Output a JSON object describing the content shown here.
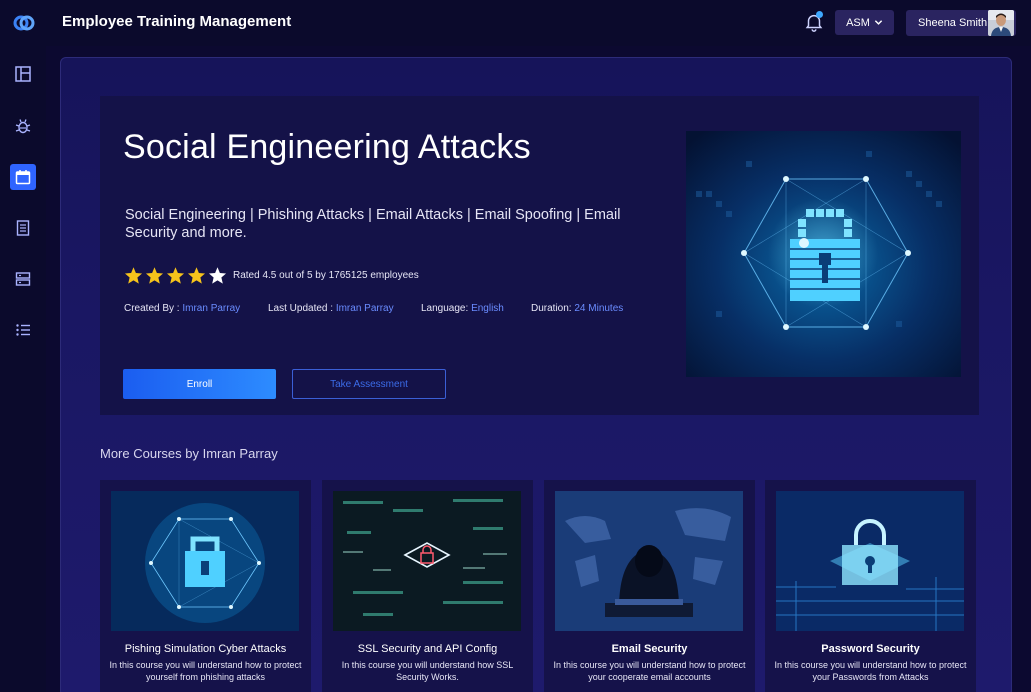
{
  "app": {
    "title": "Employee Training Management"
  },
  "header": {
    "org_selector": "ASM",
    "user_name": "Sheena Smith",
    "icons": [
      "logo-icon",
      "bell-icon",
      "chevron-down-icon"
    ]
  },
  "sidebar": {
    "items": [
      {
        "name": "dashboard",
        "icon": "layout-icon",
        "active": false
      },
      {
        "name": "bugs",
        "icon": "bug-icon",
        "active": false
      },
      {
        "name": "calendar",
        "icon": "calendar-icon",
        "active": true
      },
      {
        "name": "documents",
        "icon": "document-icon",
        "active": false
      },
      {
        "name": "storage",
        "icon": "server-icon",
        "active": false
      },
      {
        "name": "list",
        "icon": "list-icon",
        "active": false
      }
    ]
  },
  "course": {
    "title": "Social Engineering Attacks",
    "tags": "Social Engineering | Phishing Attacks | Email Attacks | Email Spoofing | Email Security and more.",
    "rating_stars": 4.5,
    "rating_text": "Rated 4.5 out of 5 by 1765125 employees",
    "created_by_label": "Created By : ",
    "created_by": "Imran Parray",
    "last_updated_label": "Last Updated : ",
    "last_updated": "Imran Parray",
    "language_label": "Language: ",
    "language": "English",
    "duration_label": "Duration: ",
    "duration": "24 Minutes",
    "enroll_label": "Enroll",
    "assessment_label": "Take Assessment"
  },
  "more": {
    "title": "More Courses by Imran Parray",
    "cards": [
      {
        "title": "Pishing Simulation Cyber Attacks",
        "desc": "In this course you will understand how to protect yourself from phishing attacks"
      },
      {
        "title": "SSL Security and API Config",
        "desc": "In this course you will understand how SSL Security Works."
      },
      {
        "title": "Email Security",
        "desc": "In this course you will understand how to protect your cooperate email accounts"
      },
      {
        "title": "Password Security",
        "desc": "In this course you will understand how to protect your Passwords from Attacks"
      }
    ]
  },
  "colors": {
    "accent": "#2f64ff",
    "link": "#6a8cff",
    "background": "#0c0930"
  }
}
